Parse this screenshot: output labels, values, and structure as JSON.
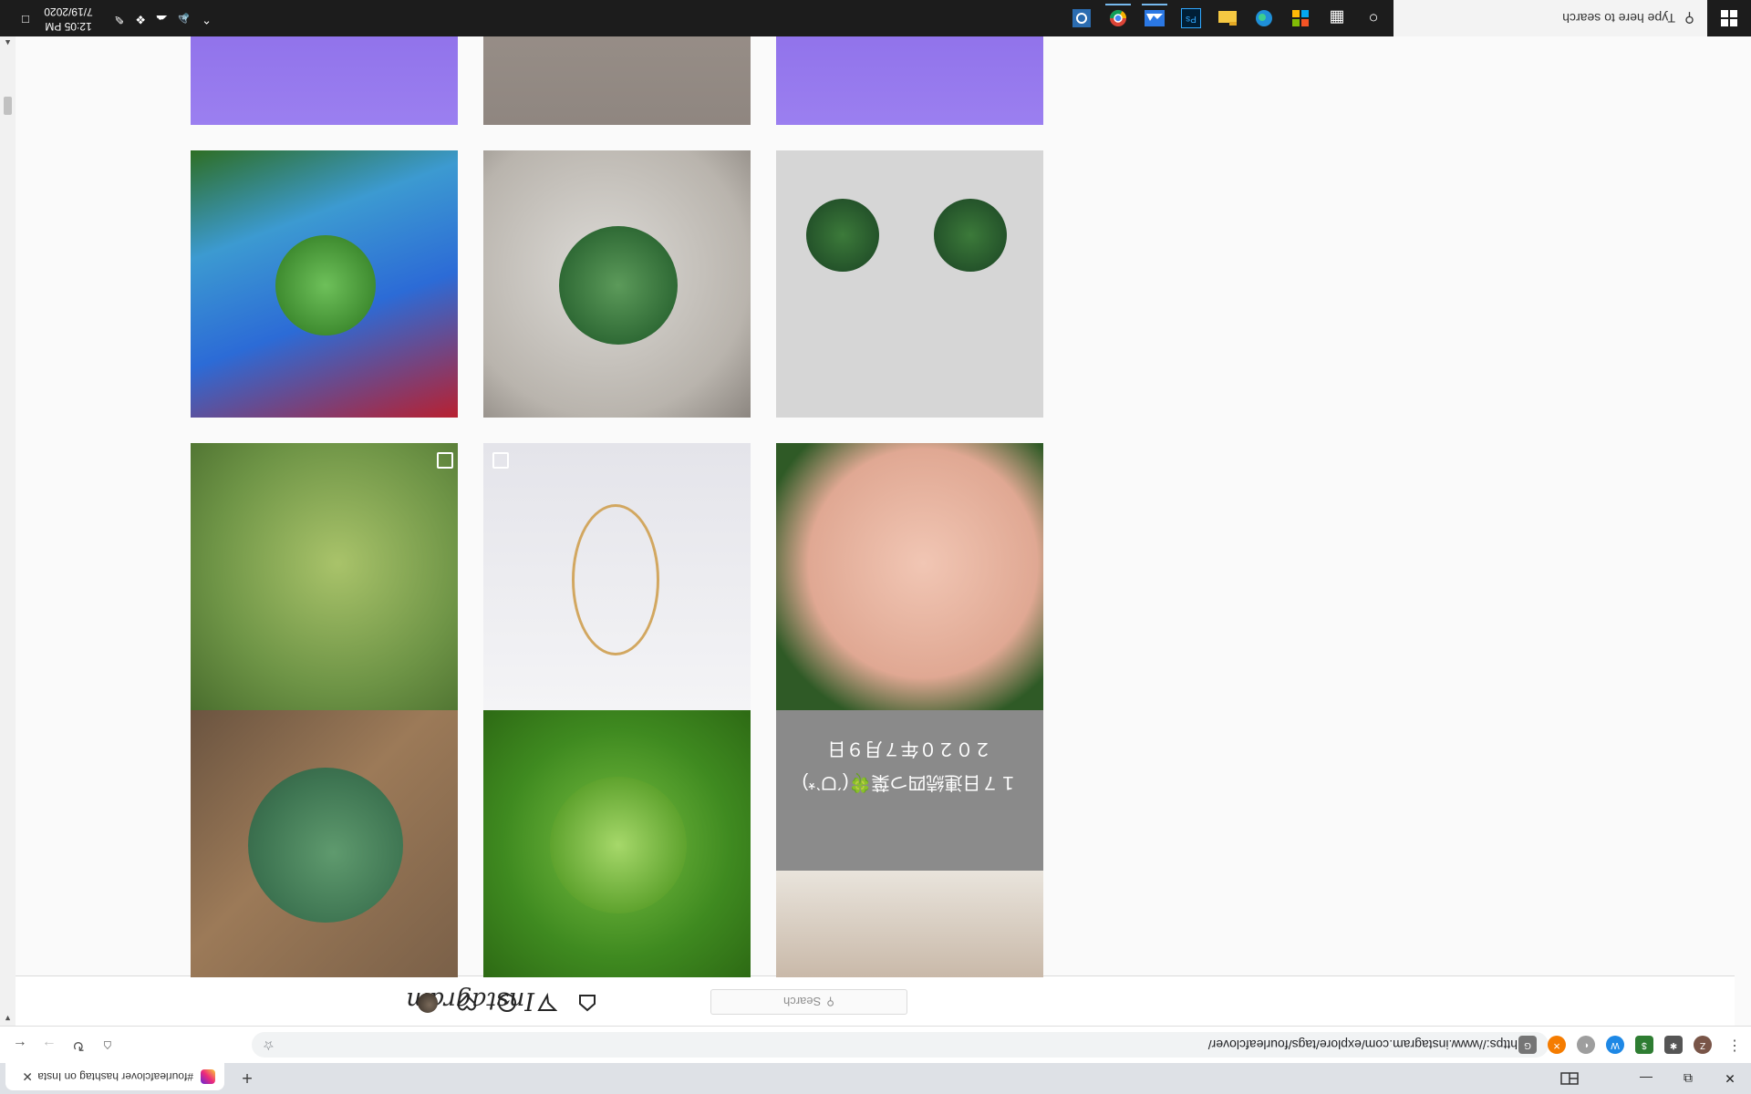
{
  "browser": {
    "tab_title": "#fourleafclover hashtag on Insta",
    "new_tab": "+",
    "tab_close": "✕",
    "url": "https://www.instagram.com/explore/tags/fourleafclover/",
    "extensions": [
      "Z",
      "✱",
      "$",
      "W",
      "◐",
      "✕",
      "G"
    ]
  },
  "instagram": {
    "logo": "Instagram",
    "search_placeholder": "Search"
  },
  "grid": {
    "caption_line1": "１７日連続四つ葉🍀(ˊᗜˋ*)",
    "caption_line2": "２０２０年７月９日"
  },
  "taskbar": {
    "search_text": "Type here to search",
    "time": "12:05 PM",
    "date": "7/19/2020"
  }
}
